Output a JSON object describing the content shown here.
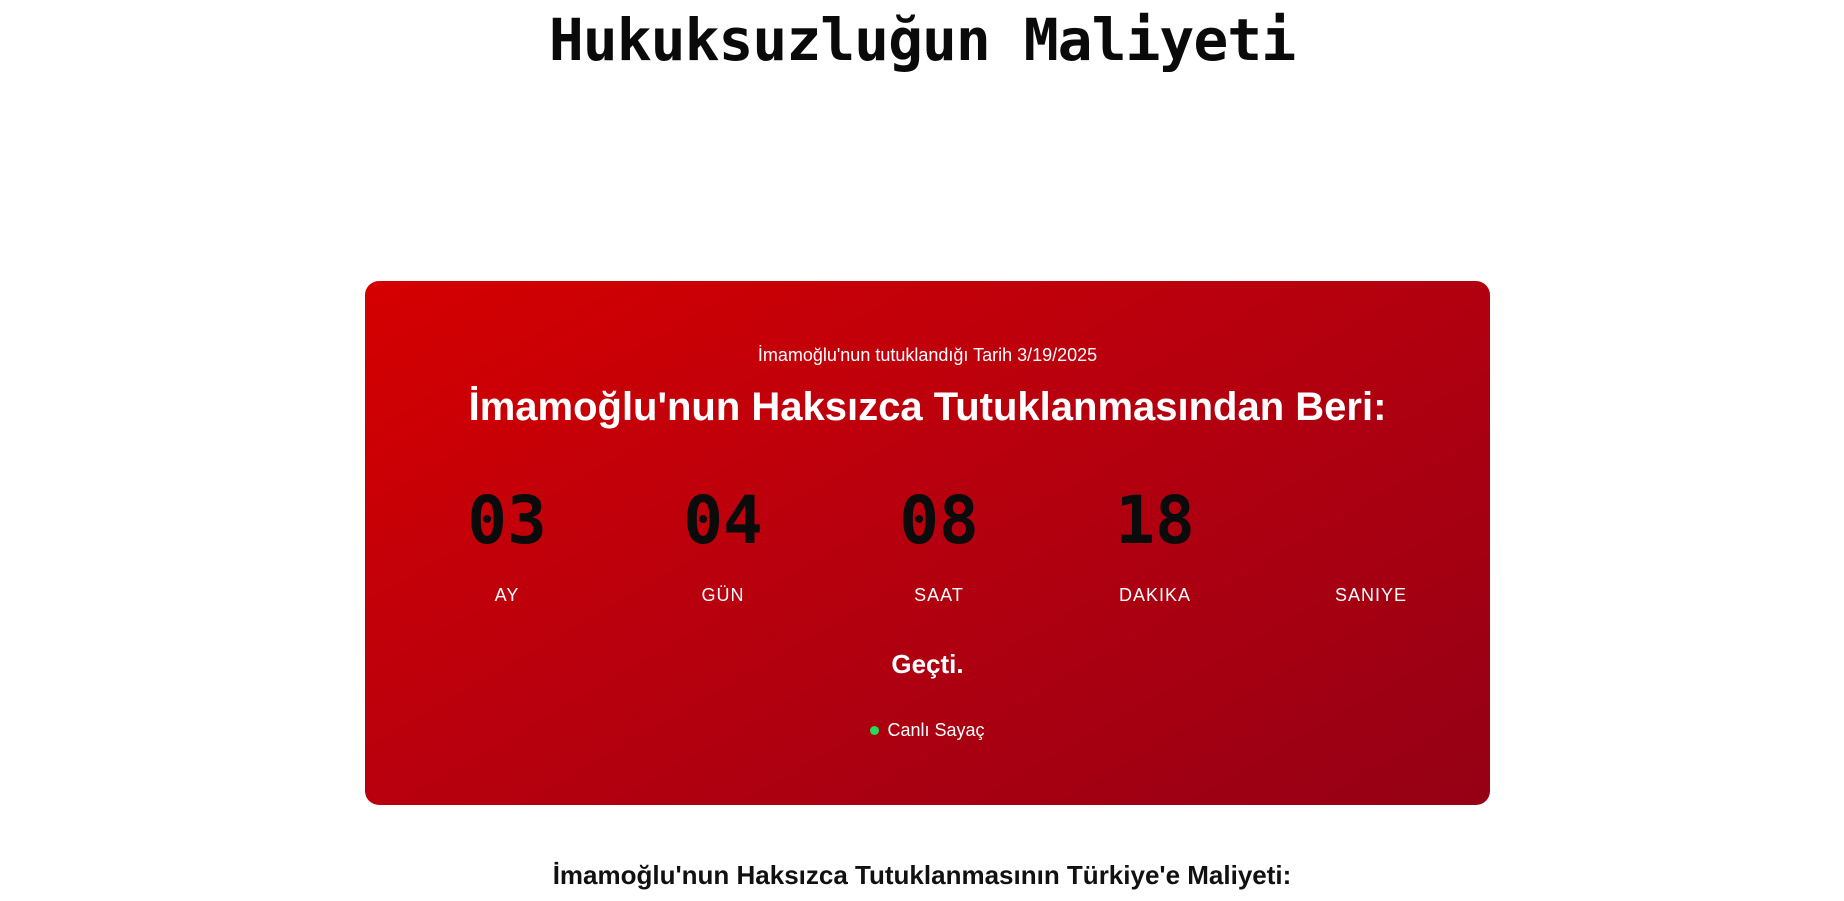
{
  "site": {
    "title": "Hukuksuzluğun Maliyeti"
  },
  "counter": {
    "date_line": "İmamoğlu'nun tutuklandığı Tarih 3/19/2025",
    "heading": "İmamoğlu'nun Haksızca Tutuklanmasından Beri:",
    "units": [
      {
        "value": "03",
        "label": "AY"
      },
      {
        "value": "04",
        "label": "GÜN"
      },
      {
        "value": "08",
        "label": "SAAT"
      },
      {
        "value": "18",
        "label": "DAKIKA"
      },
      {
        "value": "",
        "label": "SANIYE"
      }
    ],
    "passed": "Geçti.",
    "live_label": "Canlı Sayaç",
    "live_indicator_color": "#22dd55",
    "card_colors": [
      "#d50000",
      "#950015"
    ]
  },
  "section": {
    "cost_heading": "İmamoğlu'nun Haksızca Tutuklanmasının Türkiye'e Maliyeti:"
  }
}
